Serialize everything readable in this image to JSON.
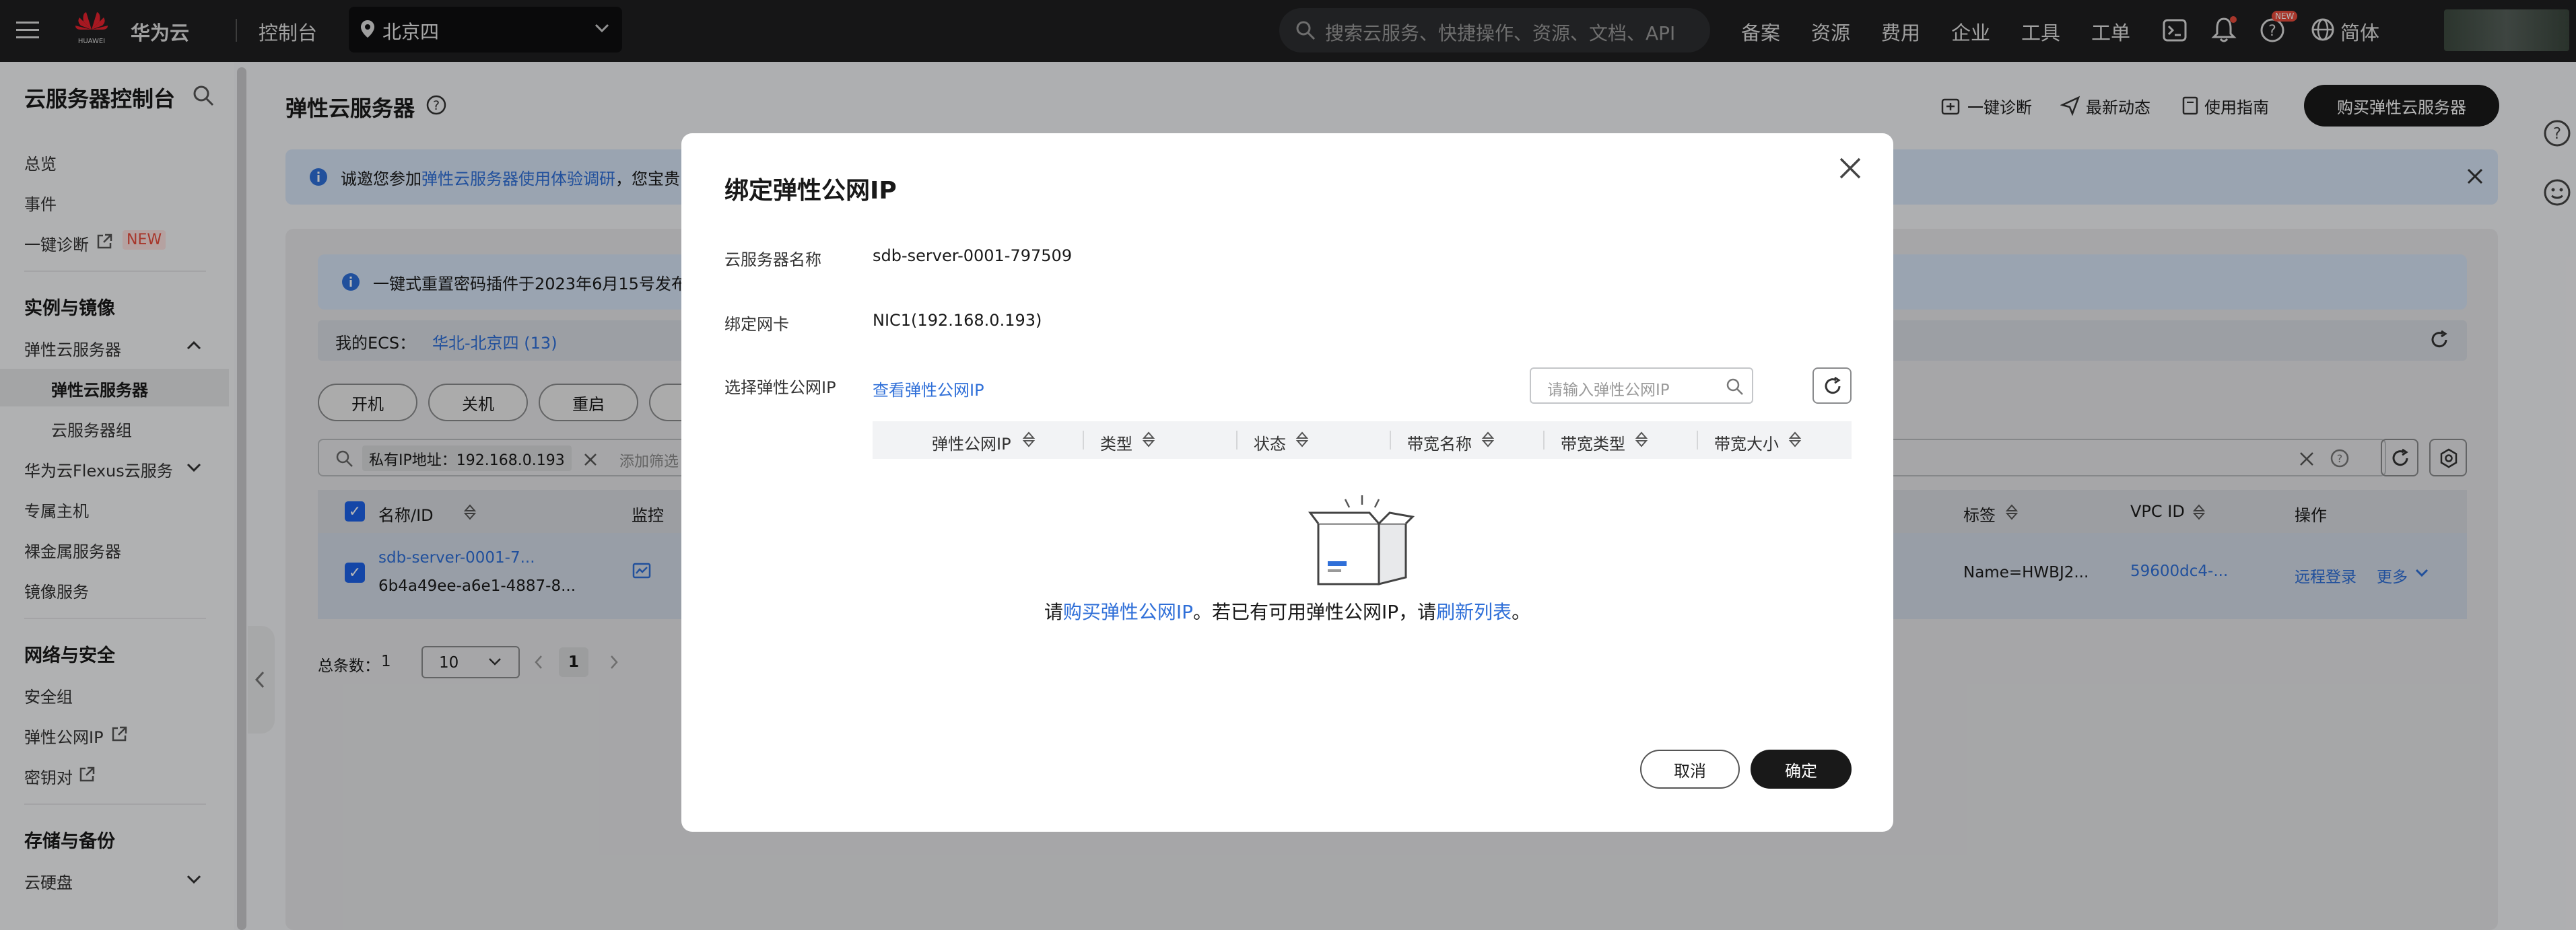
{
  "topbar": {
    "brand_sub": "HUAWEI",
    "brand": "华为云",
    "console": "控制台",
    "region": "北京四",
    "search_placeholder": "搜索云服务、快捷操作、资源、文档、API",
    "nav": [
      "备案",
      "资源",
      "费用",
      "企业",
      "工具",
      "工单"
    ],
    "badge_new": "NEW",
    "lang": "简体"
  },
  "sidebar": {
    "title": "云服务器控制台",
    "items_top": [
      "总览",
      "事件",
      "一键诊断"
    ],
    "new_badge": "NEW",
    "section1": "实例与镜像",
    "ecs_group": "弹性云服务器",
    "ecs_sub": [
      "弹性云服务器",
      "云服务器组"
    ],
    "items_mid": [
      "华为云Flexus云服务",
      "专属主机",
      "裸金属服务器",
      "镜像服务"
    ],
    "section2": "网络与安全",
    "items_net": [
      "安全组",
      "弹性公网IP",
      "密钥对"
    ],
    "section3": "存储与备份",
    "items_storage": [
      "云硬盘"
    ]
  },
  "page": {
    "title": "弹性云服务器",
    "actions": [
      "一键诊断",
      "最新动态",
      "使用指南"
    ],
    "buy_button": "购买弹性云服务器",
    "banner1_prefix": "诚邀您参加",
    "banner1_link": "弹性云服务器使用体验调研",
    "banner1_suffix": "，您宝贵",
    "banner2": "一键式重置密码插件于2023年6月15号发布",
    "my_ecs_label": "我的ECS：",
    "my_ecs_region": "华北-北京四 (13)",
    "action_buttons": [
      "开机",
      "关机",
      "重启"
    ],
    "filter_tag": "私有IP地址：192.168.0.193",
    "filter_add": "添加筛选",
    "table_headers": {
      "name": "名称/ID",
      "monitor": "监控",
      "tag": "标签",
      "vpc": "VPC ID",
      "ops": "操作"
    },
    "row": {
      "name": "sdb-server-0001-7...",
      "id": "6b4a49ee-a6e1-4887-8...",
      "tag": "Name=HWBJ2...",
      "vpc": "59600dc4-...",
      "remote": "远程登录",
      "more": "更多"
    },
    "total_label": "总条数：",
    "total": "1",
    "page_size": "10",
    "page_num": "1"
  },
  "modal": {
    "title": "绑定弹性公网IP",
    "server_name_label": "云服务器名称",
    "server_name": "sdb-server-0001-797509",
    "nic_label": "绑定网卡",
    "nic": "NIC1(192.168.0.193)",
    "select_label": "选择弹性公网IP",
    "view_link": "查看弹性公网IP",
    "search_placeholder": "请输入弹性公网IP",
    "columns": [
      "弹性公网IP",
      "类型",
      "状态",
      "带宽名称",
      "带宽类型",
      "带宽大小"
    ],
    "empty_prefix": "请",
    "empty_link1": "购买弹性公网IP",
    "empty_middle": "。若已有可用弹性公网IP，请",
    "empty_link2": "刷新列表",
    "empty_suffix": "。",
    "cancel": "取消",
    "confirm": "确定"
  },
  "colors": {
    "accent": "#2f6fd8",
    "primary_button": "#191919",
    "new_badge": "#e84b3c"
  }
}
